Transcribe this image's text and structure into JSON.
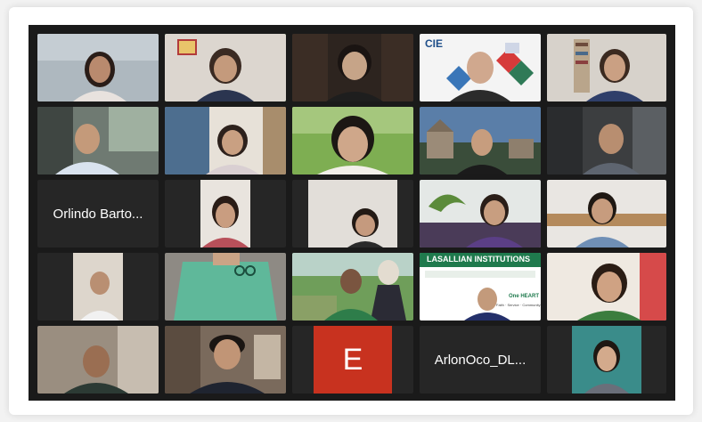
{
  "participants": {
    "orlindo": {
      "name": "Orlindo Barto..."
    },
    "arlon": {
      "name": "ArlonOco_DL..."
    },
    "e_avatar": {
      "letter": "E"
    }
  },
  "backgrounds": {
    "cie_logo": "CIE",
    "lasallian_banner": "LASALLIAN INSTITUTIONS",
    "one_heart": "One HEART",
    "one_heart_sub": "Faith · Service · Community"
  },
  "colors": {
    "meeting_bg": "#1a1a1a",
    "active_speaker": "#4cbb3f",
    "avatar_bg": "#c8321f"
  }
}
